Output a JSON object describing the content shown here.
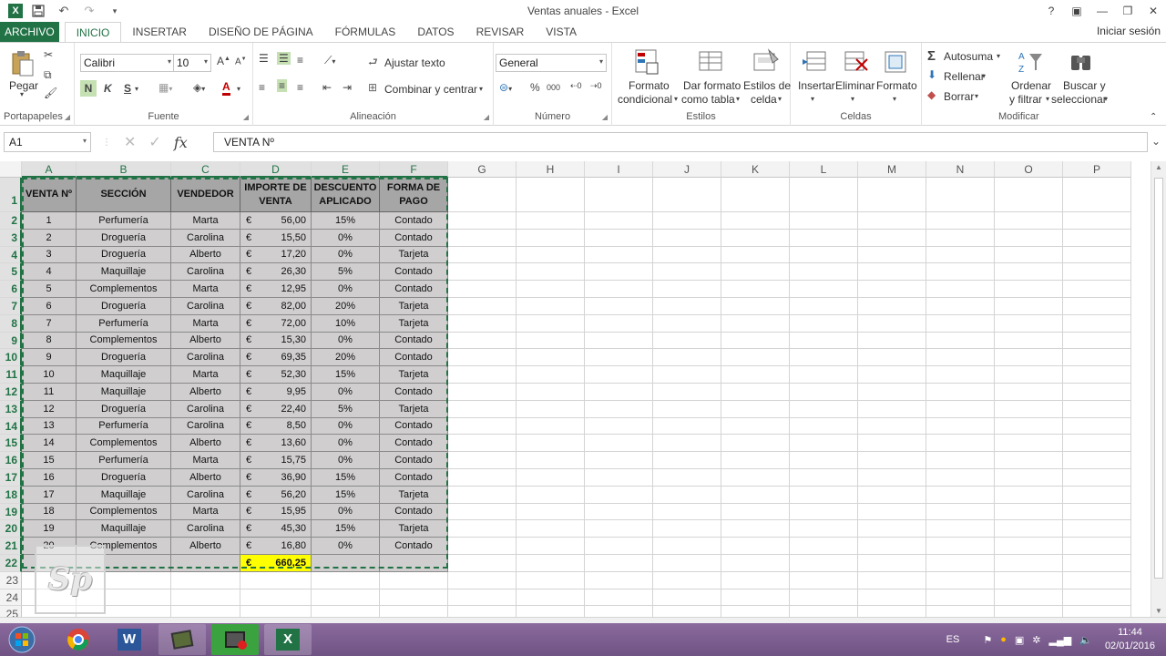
{
  "window": {
    "title": "Ventas anuales - Excel",
    "help": "?",
    "signin": "Iniciar sesión"
  },
  "tabs": [
    "ARCHIVO",
    "INICIO",
    "INSERTAR",
    "DISEÑO DE PÁGINA",
    "FÓRMULAS",
    "DATOS",
    "REVISAR",
    "VISTA"
  ],
  "ribbon": {
    "clipboard": {
      "label": "Portapapeles",
      "paste": "Pegar"
    },
    "font": {
      "label": "Fuente",
      "name": "Calibri",
      "size": "10",
      "bold": "N",
      "italic": "K",
      "underline": "S"
    },
    "alignment": {
      "label": "Alineación",
      "wrap": "Ajustar texto",
      "merge": "Combinar y centrar"
    },
    "number": {
      "label": "Número",
      "format": "General",
      "percent": "%",
      "thousands": "000"
    },
    "styles": {
      "label": "Estilos",
      "conditional1": "Formato",
      "conditional2": "condicional",
      "table1": "Dar formato",
      "table2": "como tabla",
      "cell1": "Estilos de",
      "cell2": "celda"
    },
    "cells": {
      "label": "Celdas",
      "insert": "Insertar",
      "delete": "Eliminar",
      "format": "Formato"
    },
    "editing": {
      "label": "Modificar",
      "autosum": "Autosuma",
      "fill": "Rellenar",
      "clear": "Borrar",
      "sort1": "Ordenar",
      "sort2": "y filtrar",
      "find1": "Buscar y",
      "find2": "seleccionar"
    }
  },
  "formula_bar": {
    "name_box": "A1",
    "fx": "fx",
    "content": "VENTA Nº"
  },
  "columns": [
    "A",
    "B",
    "C",
    "D",
    "E",
    "F",
    "G",
    "H",
    "I",
    "J",
    "K",
    "L",
    "M",
    "N",
    "O",
    "P"
  ],
  "table": {
    "headers": [
      "VENTA Nº",
      "SECCIÓN",
      "VENDEDOR",
      "IMPORTE DE VENTA",
      "DESCUENTO APLICADO",
      "FORMA DE PAGO"
    ],
    "currency": "€",
    "rows": [
      [
        "1",
        "Perfumería",
        "Marta",
        "56,00",
        "15%",
        "Contado"
      ],
      [
        "2",
        "Droguería",
        "Carolina",
        "15,50",
        "0%",
        "Contado"
      ],
      [
        "3",
        "Droguería",
        "Alberto",
        "17,20",
        "0%",
        "Tarjeta"
      ],
      [
        "4",
        "Maquillaje",
        "Carolina",
        "26,30",
        "5%",
        "Contado"
      ],
      [
        "5",
        "Complementos",
        "Marta",
        "12,95",
        "0%",
        "Contado"
      ],
      [
        "6",
        "Droguería",
        "Carolina",
        "82,00",
        "20%",
        "Tarjeta"
      ],
      [
        "7",
        "Perfumería",
        "Marta",
        "72,00",
        "10%",
        "Tarjeta"
      ],
      [
        "8",
        "Complementos",
        "Alberto",
        "15,30",
        "0%",
        "Contado"
      ],
      [
        "9",
        "Droguería",
        "Carolina",
        "69,35",
        "20%",
        "Contado"
      ],
      [
        "10",
        "Maquillaje",
        "Marta",
        "52,30",
        "15%",
        "Tarjeta"
      ],
      [
        "11",
        "Maquillaje",
        "Alberto",
        "9,95",
        "0%",
        "Contado"
      ],
      [
        "12",
        "Droguería",
        "Carolina",
        "22,40",
        "5%",
        "Tarjeta"
      ],
      [
        "13",
        "Perfumería",
        "Carolina",
        "8,50",
        "0%",
        "Contado"
      ],
      [
        "14",
        "Complementos",
        "Alberto",
        "13,60",
        "0%",
        "Contado"
      ],
      [
        "15",
        "Perfumería",
        "Marta",
        "15,75",
        "0%",
        "Contado"
      ],
      [
        "16",
        "Droguería",
        "Alberto",
        "36,90",
        "15%",
        "Contado"
      ],
      [
        "17",
        "Maquillaje",
        "Carolina",
        "56,20",
        "15%",
        "Tarjeta"
      ],
      [
        "18",
        "Complementos",
        "Marta",
        "15,95",
        "0%",
        "Contado"
      ],
      [
        "19",
        "Maquillaje",
        "Carolina",
        "45,30",
        "15%",
        "Tarjeta"
      ],
      [
        "20",
        "Complementos",
        "Alberto",
        "16,80",
        "0%",
        "Contado"
      ]
    ],
    "total": "660,25"
  },
  "row_numbers": [
    "1",
    "2",
    "3",
    "4",
    "5",
    "6",
    "7",
    "8",
    "9",
    "10",
    "11",
    "12",
    "13",
    "14",
    "15",
    "16",
    "17",
    "18",
    "19",
    "20",
    "21",
    "22",
    "23",
    "24",
    "25"
  ],
  "watermark": "Sp",
  "taskbar": {
    "language": "ES",
    "time": "11:44",
    "date": "02/01/2016"
  },
  "colors": {
    "excel_green": "#217346",
    "table_header": "#a6a6a6",
    "table_body": "#d0cece",
    "total_highlight": "#ffff00",
    "taskbar": "#7d5e91"
  }
}
